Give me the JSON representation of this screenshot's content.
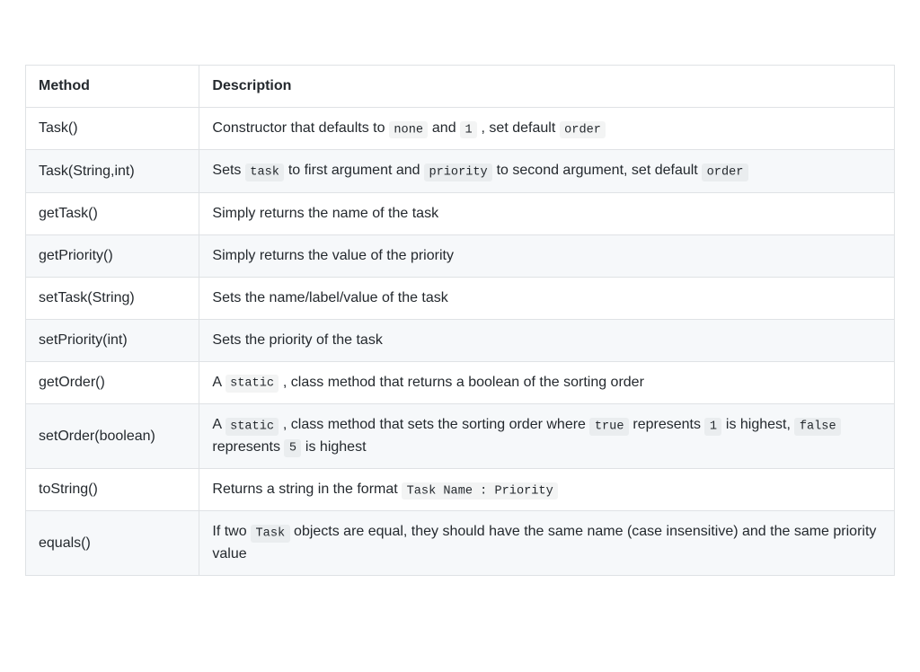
{
  "table": {
    "headers": {
      "method": "Method",
      "description": "Description"
    },
    "rows": [
      {
        "method": "Task()",
        "desc": [
          {
            "t": "text",
            "v": "Constructor that defaults to "
          },
          {
            "t": "code",
            "v": "none"
          },
          {
            "t": "text",
            "v": " and "
          },
          {
            "t": "code",
            "v": "1"
          },
          {
            "t": "text",
            "v": " , set default "
          },
          {
            "t": "code",
            "v": "order"
          }
        ]
      },
      {
        "method": "Task(String,int)",
        "desc": [
          {
            "t": "text",
            "v": "Sets "
          },
          {
            "t": "code",
            "v": "task"
          },
          {
            "t": "text",
            "v": " to first argument and "
          },
          {
            "t": "code",
            "v": "priority"
          },
          {
            "t": "text",
            "v": " to second argument, set default "
          },
          {
            "t": "code",
            "v": "order"
          }
        ]
      },
      {
        "method": "getTask()",
        "desc": [
          {
            "t": "text",
            "v": "Simply returns the name of the task"
          }
        ]
      },
      {
        "method": "getPriority()",
        "desc": [
          {
            "t": "text",
            "v": "Simply returns the value of the priority"
          }
        ]
      },
      {
        "method": "setTask(String)",
        "desc": [
          {
            "t": "text",
            "v": "Sets the name/label/value of the task"
          }
        ]
      },
      {
        "method": "setPriority(int)",
        "desc": [
          {
            "t": "text",
            "v": "Sets the priority of the task"
          }
        ]
      },
      {
        "method": "getOrder()",
        "desc": [
          {
            "t": "text",
            "v": "A "
          },
          {
            "t": "code",
            "v": "static"
          },
          {
            "t": "text",
            "v": " , class method that returns a boolean of the sorting order"
          }
        ]
      },
      {
        "method": "setOrder(boolean)",
        "desc": [
          {
            "t": "text",
            "v": "A "
          },
          {
            "t": "code",
            "v": "static"
          },
          {
            "t": "text",
            "v": " , class method that sets the sorting order where "
          },
          {
            "t": "code",
            "v": "true"
          },
          {
            "t": "text",
            "v": " represents "
          },
          {
            "t": "code",
            "v": "1"
          },
          {
            "t": "text",
            "v": " is highest, "
          },
          {
            "t": "code",
            "v": "false"
          },
          {
            "t": "text",
            "v": " represents "
          },
          {
            "t": "code",
            "v": "5"
          },
          {
            "t": "text",
            "v": " is highest"
          }
        ]
      },
      {
        "method": "toString()",
        "desc": [
          {
            "t": "text",
            "v": "Returns a string in the format "
          },
          {
            "t": "code",
            "v": "Task Name : Priority"
          }
        ]
      },
      {
        "method": "equals()",
        "desc": [
          {
            "t": "text",
            "v": "If two "
          },
          {
            "t": "code",
            "v": "Task"
          },
          {
            "t": "text",
            "v": " objects are equal, they should have the same name (case insensitive) and the same priority value"
          }
        ]
      }
    ]
  }
}
